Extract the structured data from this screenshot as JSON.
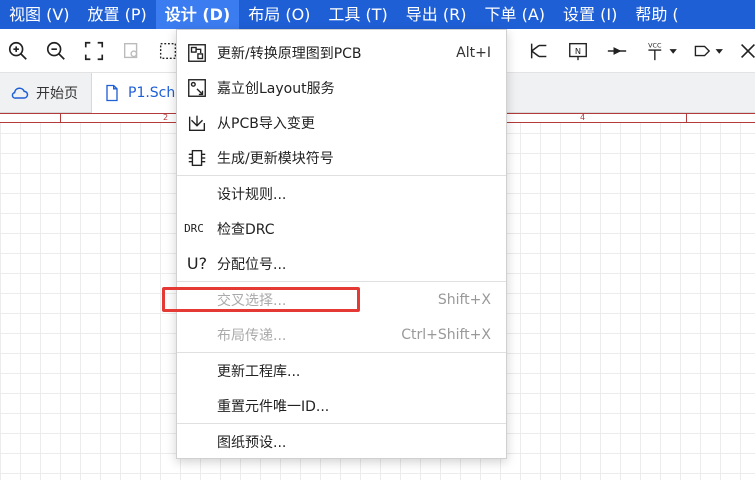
{
  "menubar": {
    "items": [
      {
        "label": "视图 (V)"
      },
      {
        "label": "放置 (P)"
      },
      {
        "label": "设计 (D)"
      },
      {
        "label": "布局 (O)"
      },
      {
        "label": "工具 (T)"
      },
      {
        "label": "导出 (R)"
      },
      {
        "label": "下单 (A)"
      },
      {
        "label": "设置 (I)"
      },
      {
        "label": "帮助 ("
      }
    ]
  },
  "toolbar": {
    "vcc_label": "VCC",
    "netflag_label": "N"
  },
  "tabs": [
    {
      "label": "开始页"
    },
    {
      "label": "P1.Sch"
    }
  ],
  "ruler": {
    "labels": [
      "2",
      "4"
    ]
  },
  "design_menu": {
    "items": [
      {
        "label": "更新/转换原理图到PCB",
        "shortcut": "Alt+I",
        "icon": "update-pcb-icon"
      },
      {
        "label": "嘉立创Layout服务",
        "shortcut": "",
        "icon": "layout-service-icon"
      },
      {
        "label": "从PCB导入变更",
        "shortcut": "",
        "icon": "import-changes-icon"
      },
      {
        "label": "生成/更新模块符号",
        "shortcut": "",
        "icon": "module-symbol-icon"
      },
      {
        "label": "设计规则...",
        "shortcut": "",
        "icon": ""
      },
      {
        "label": "检查DRC",
        "shortcut": "",
        "icon": "drc-icon",
        "icon_text": "DRC"
      },
      {
        "label": "分配位号...",
        "shortcut": "",
        "icon": "annotate-icon",
        "icon_text": "U?"
      },
      {
        "label": "交叉选择...",
        "shortcut": "Shift+X",
        "icon": "",
        "disabled": true
      },
      {
        "label": "布局传递...",
        "shortcut": "Ctrl+Shift+X",
        "icon": "",
        "disabled": true
      },
      {
        "label": "更新工程库...",
        "shortcut": "",
        "icon": ""
      },
      {
        "label": "重置元件唯一ID...",
        "shortcut": "",
        "icon": ""
      },
      {
        "label": "图纸预设...",
        "shortcut": "",
        "icon": ""
      }
    ]
  },
  "colors": {
    "menubar_bg": "#1f5fd6",
    "highlight_box": "#e53935",
    "ruler": "#b23a3a"
  }
}
